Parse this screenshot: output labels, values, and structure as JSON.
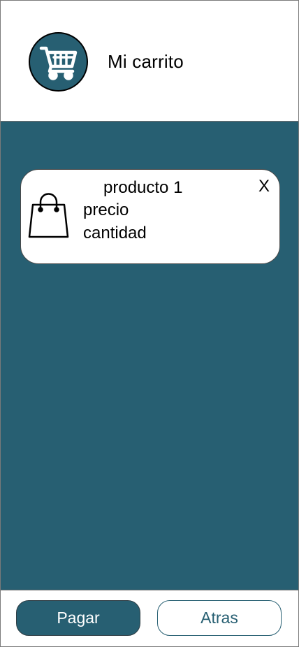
{
  "header": {
    "title": "Mi carrito",
    "icon": "shopping-cart-icon"
  },
  "cart": {
    "items": [
      {
        "name": "producto 1",
        "price_label": "precio",
        "quantity_label": "cantidad",
        "remove_label": "X",
        "icon": "shopping-bag-icon"
      }
    ]
  },
  "footer": {
    "pay_label": "Pagar",
    "back_label": "Atras"
  },
  "colors": {
    "primary": "#275f72",
    "background": "#ffffff",
    "text": "#000000"
  }
}
